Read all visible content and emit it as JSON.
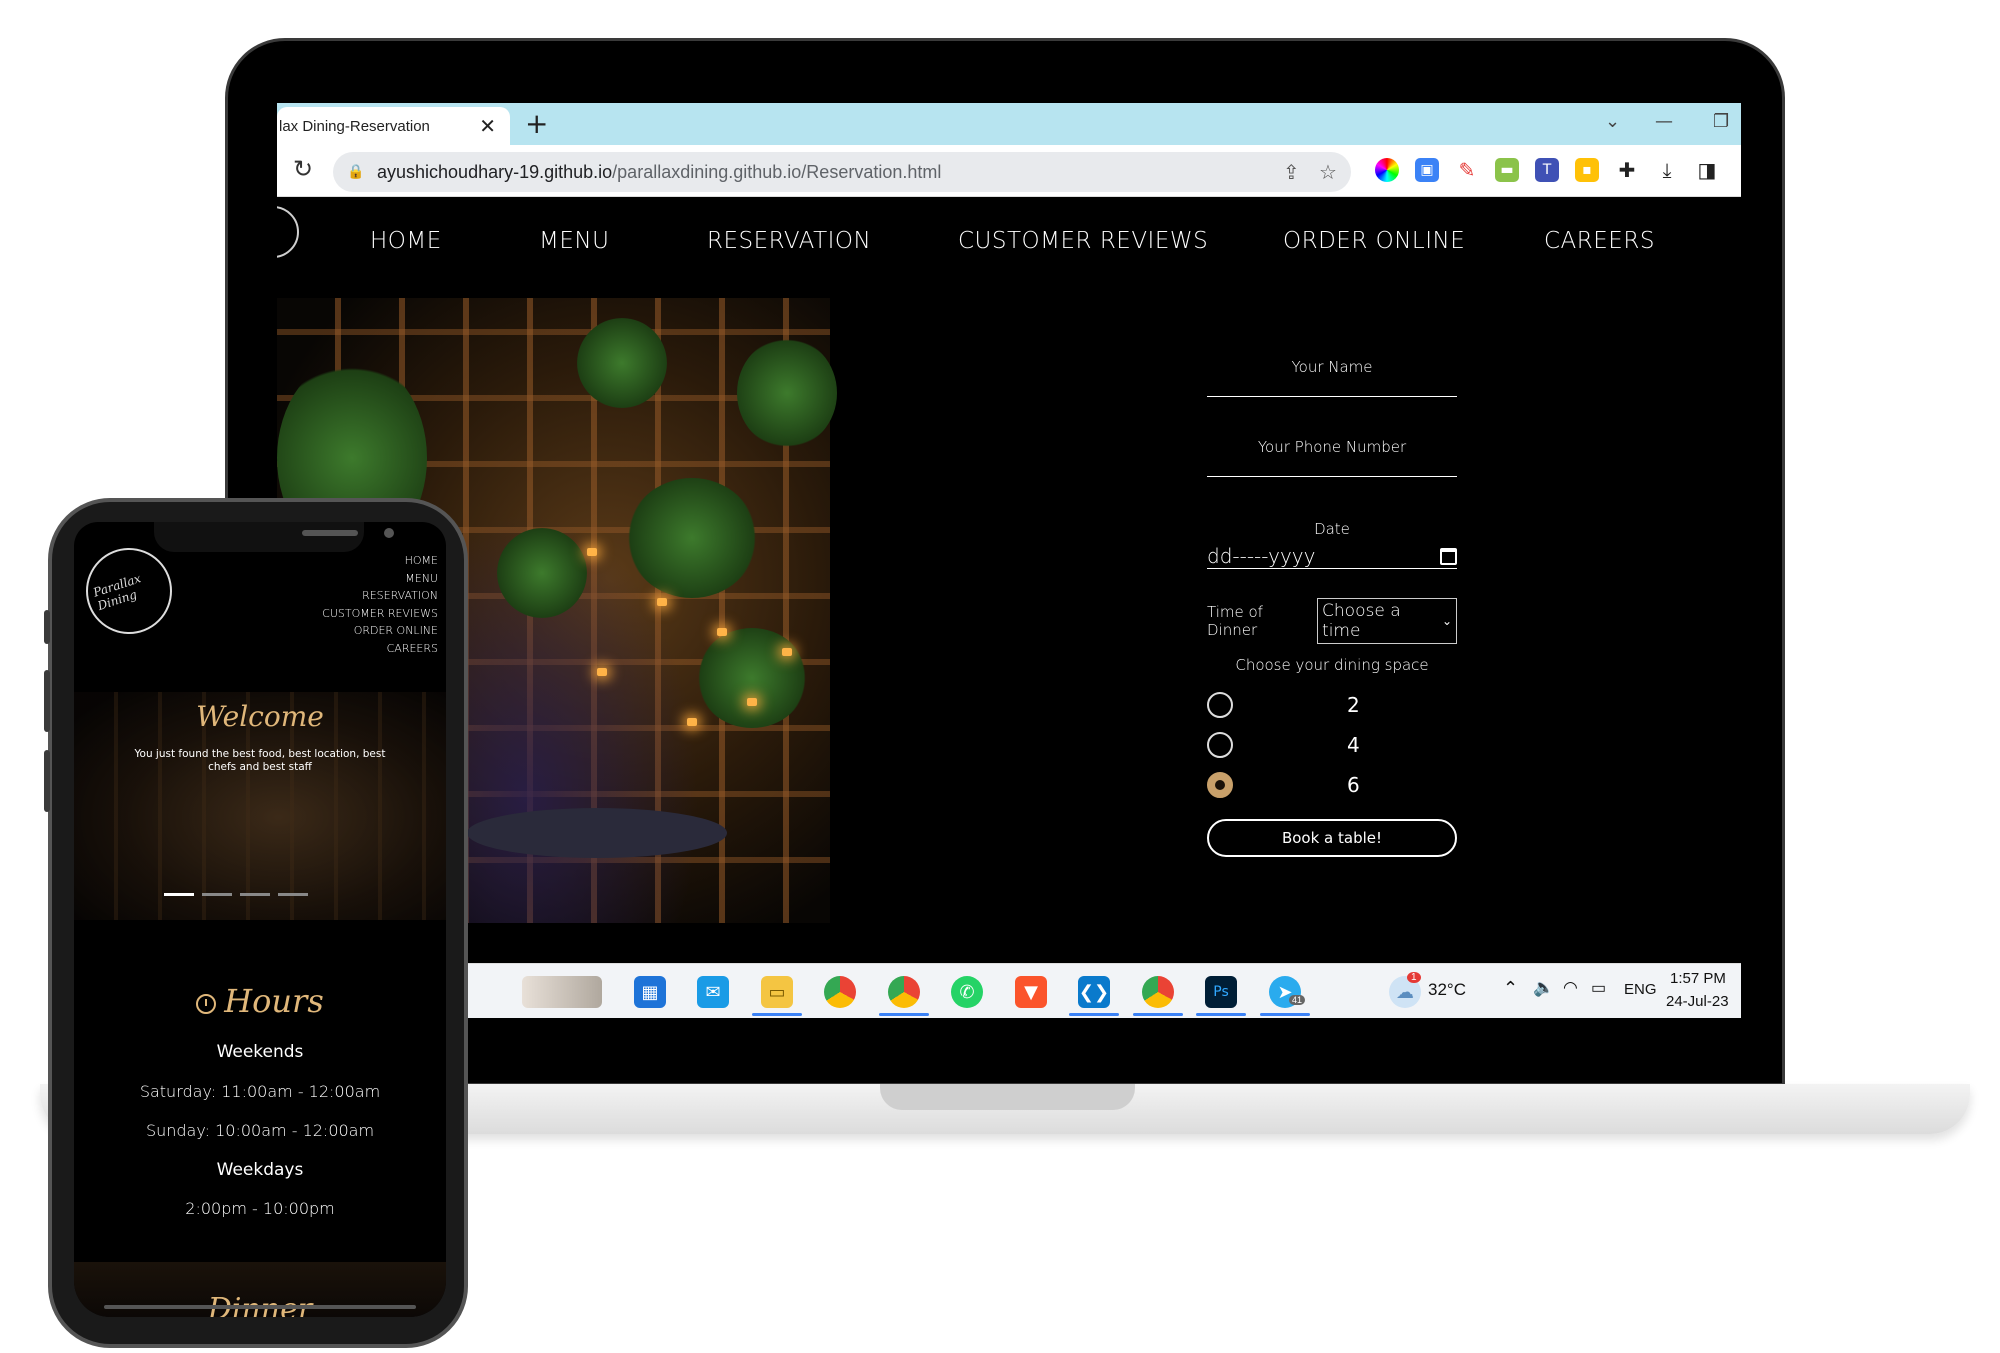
{
  "browser": {
    "tab_title": "lax Dining-Reservation",
    "tab_close": "✕",
    "new_tab": "+",
    "url_host": "ayushichoudhary-19.github.io",
    "url_path": "/parallaxdining.github.io/Reservation.html"
  },
  "site": {
    "nav": [
      "HOME",
      "MENU",
      "RESERVATION",
      "CUSTOMER REVIEWS",
      "ORDER ONLINE",
      "CAREERS"
    ],
    "form": {
      "name_placeholder": "Your Name",
      "phone_placeholder": "Your Phone Number",
      "date_label": "Date",
      "date_value": "dd-----yyyy",
      "time_label": "Time of Dinner",
      "time_value": "Choose a time",
      "space_label": "Choose your dining space",
      "options": [
        "2",
        "4",
        "6"
      ],
      "selected_option": "6",
      "submit_label": "Book a table!"
    }
  },
  "taskbar": {
    "weather": "32°C",
    "weather_badge": "1",
    "language": "ENG",
    "time": "1:57 PM",
    "date": "24-Jul-23",
    "telegram_badge": "41"
  },
  "phone": {
    "logo_text": "Parallax Dining",
    "nav": [
      "HOME",
      "MENU",
      "RESERVATION",
      "CUSTOMER REVIEWS",
      "ORDER ONLINE",
      "CAREERS"
    ],
    "welcome": "Welcome",
    "tagline": "You just found the best food, best location, best chefs and best staff",
    "hours_title": "Hours",
    "hours": {
      "weekends_label": "Weekends",
      "saturday": "Saturday: 11:00am - 12:00am",
      "sunday": "Sunday: 10:00am - 12:00am",
      "weekdays_label": "Weekdays",
      "weekdays": "2:00pm - 10:00pm"
    },
    "next_section": "Dinner"
  },
  "colors": {
    "accent_gold": "#e0b77a",
    "tabbar": "#b7e4f0",
    "radio_selected": "#c8a06a"
  }
}
